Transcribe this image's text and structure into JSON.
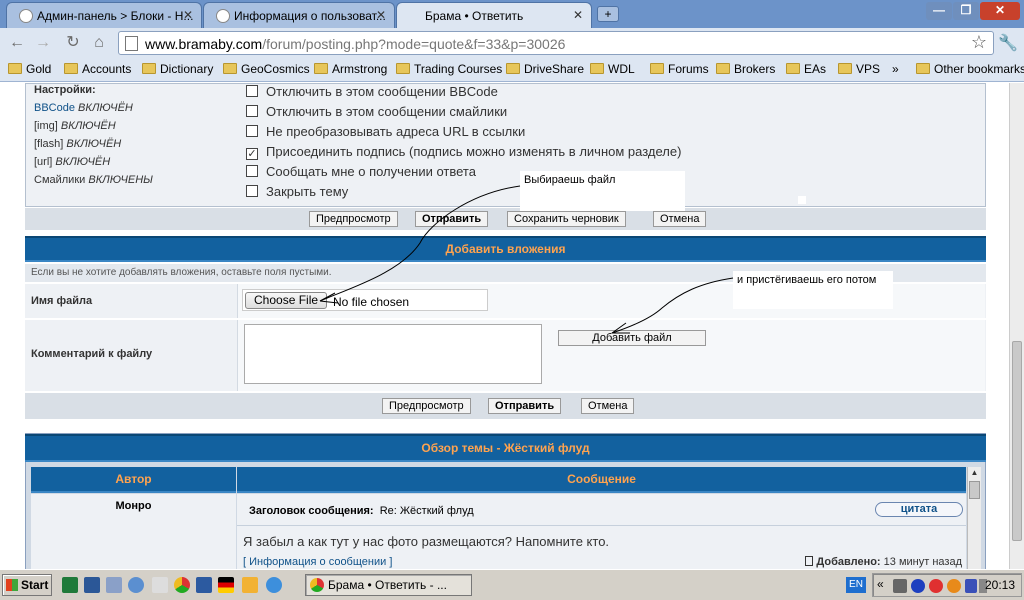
{
  "browser": {
    "tabs": [
      {
        "label": "Админ-панель > Блоки - Н..."
      },
      {
        "label": "Информация о пользоват..."
      },
      {
        "label": "Брама • Ответить"
      }
    ],
    "close_glyph": "✕",
    "new_tab_glyph": "+",
    "window_controls": {
      "minimize": "—",
      "maximize": "❐",
      "close": "✕"
    },
    "nav": {
      "back": "←",
      "forward": "→",
      "reload": "↻",
      "home": "⌂"
    },
    "url_domain": "www.bramaby.com",
    "url_path": "/forum/posting.php?mode=quote&f=33&p=30026",
    "star_glyph": "☆",
    "wrench_glyph": "🔧",
    "bookmarks": [
      "Gold",
      "Accounts",
      "Dictionary",
      "GeoCosmics",
      "Armstrong",
      "Trading Courses",
      "DriveShare",
      "WDL",
      "Forums",
      "Brokers",
      "EAs",
      "VPS"
    ],
    "bookmarks_more": "»",
    "other_bookmarks": "Other bookmarks"
  },
  "settings": {
    "heading": "Настройки:",
    "items": [
      {
        "key": "BBCode",
        "value": "ВКЛЮЧЁН"
      },
      {
        "key": "[img]",
        "value": "ВКЛЮЧЁН"
      },
      {
        "key": "[flash]",
        "value": "ВКЛЮЧЁН"
      },
      {
        "key": "[url]",
        "value": "ВКЛЮЧЁН"
      },
      {
        "key": "Смайлики",
        "value": "ВКЛЮЧЕНЫ"
      }
    ]
  },
  "options": [
    {
      "label": "Отключить в этом сообщении BBCode",
      "checked": false
    },
    {
      "label": "Отключить в этом сообщении смайлики",
      "checked": false
    },
    {
      "label": "Не преобразовывать адреса URL в ссылки",
      "checked": false
    },
    {
      "label": "Присоединить подпись (подпись можно изменять в личном разделе)",
      "checked": true
    },
    {
      "label": "Сообщать мне о получении ответа",
      "checked": false
    },
    {
      "label": "Закрыть тему",
      "checked": false
    }
  ],
  "check_glyph": "✓",
  "buttons_top": {
    "preview": "Предпросмотр",
    "submit": "Отправить",
    "save_draft": "Сохранить черновик",
    "cancel": "Отмена"
  },
  "attachments": {
    "title": "Добавить вложения",
    "note": "Если вы не хотите добавлять вложения, оставьте поля пустыми.",
    "file_label": "Имя файла",
    "choose_file": "Choose File",
    "no_file": "No file chosen",
    "comment_label": "Комментарий к файлу",
    "comment_value": "",
    "add_file": "Добавить файл"
  },
  "buttons_bottom": {
    "preview": "Предпросмотр",
    "submit": "Отправить",
    "cancel": "Отмена"
  },
  "annotations": {
    "choose_file_note": "Выбираешь файл",
    "attach_note": "и пристёгиваешь его потом"
  },
  "topic_review": {
    "title": "Обзор темы - Жёсткий флуд",
    "col_author": "Автор",
    "col_message": "Сообщение",
    "author": "Монро",
    "subject_label": "Заголовок сообщения:",
    "subject": "Re: Жёсткий флуд",
    "quote_button": "цитата",
    "body": "Я забыл а как тут у нас фото размещаются? Напомните кто.",
    "info_link": "Информация о сообщении",
    "added_label": "Добавлено:",
    "added_value": "13 минут назад",
    "bracket_open": "[",
    "bracket_close": "]"
  },
  "taskbar": {
    "start": "Start",
    "active_item": "Брама • Ответить - ...",
    "lang": "EN",
    "tray_chevron": "«",
    "clock": "20:13"
  },
  "colors": {
    "header_blue": "#12619f",
    "header_text": "#ffa34f",
    "tab_bar": "#6c93c9"
  }
}
